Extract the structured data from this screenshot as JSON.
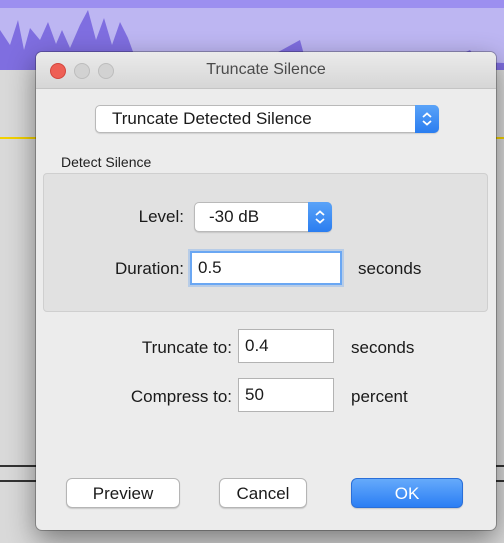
{
  "dialog": {
    "title": "Truncate Silence",
    "mode_select": {
      "selected": "Truncate Detected Silence"
    },
    "detect_silence": {
      "section_label": "Detect Silence",
      "level_label": "Level:",
      "level_value": "-30 dB",
      "duration_label": "Duration:",
      "duration_value": "0.5",
      "duration_unit": "seconds"
    },
    "truncate_to": {
      "label": "Truncate to:",
      "value": "0.4",
      "unit": "seconds"
    },
    "compress_to": {
      "label": "Compress to:",
      "value": "50",
      "unit": "percent"
    },
    "buttons": {
      "preview": "Preview",
      "cancel": "Cancel",
      "ok": "OK"
    }
  },
  "colors": {
    "accent": "#2b7ef4",
    "close": "#ee5f55",
    "waveform": "#7f6ee0"
  },
  "icons": [
    "close-icon",
    "minimize-icon",
    "zoom-icon",
    "updown-chevron-icon"
  ]
}
